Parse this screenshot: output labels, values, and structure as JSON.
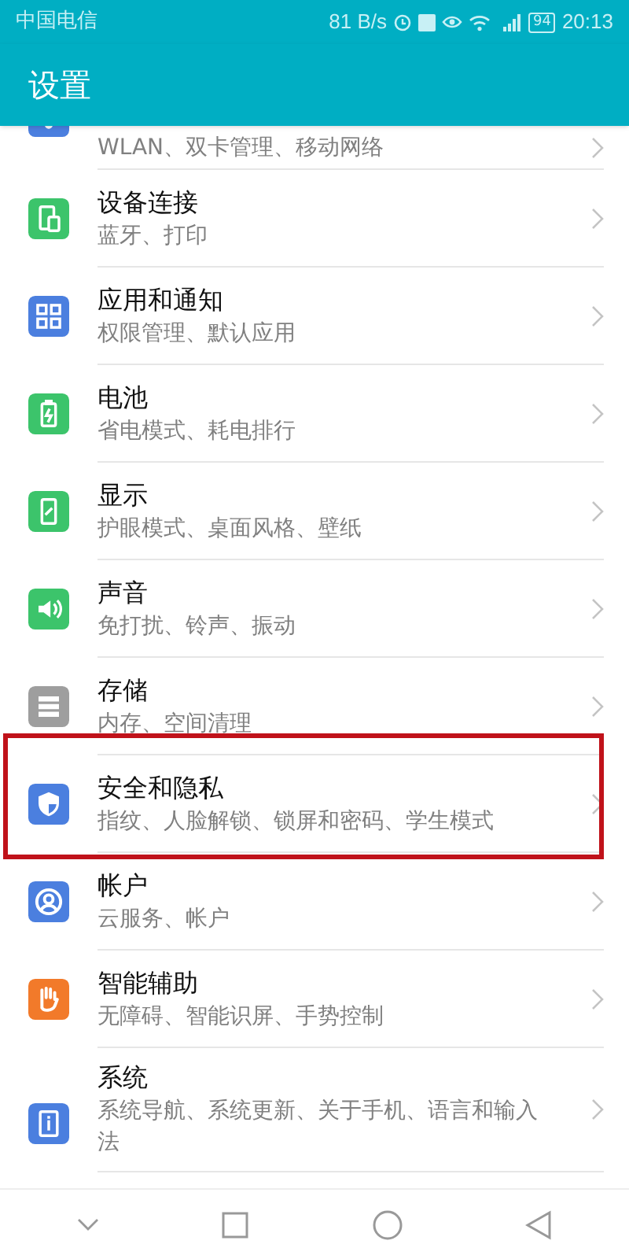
{
  "status_bar": {
    "carrier": "中国电信",
    "speed": "81 B/s",
    "battery": "94",
    "time": "20:13"
  },
  "app_bar": {
    "title": "设置"
  },
  "items": [
    {
      "kind": "wifi",
      "color": "#4b7fdf",
      "subtitle": "WLAN、双卡管理、移动网络",
      "partial": true
    },
    {
      "kind": "device",
      "color": "#3cc46b",
      "title": "设备连接",
      "subtitle": "蓝牙、打印"
    },
    {
      "kind": "apps",
      "color": "#4b7fdf",
      "title": "应用和通知",
      "subtitle": "权限管理、默认应用"
    },
    {
      "kind": "battery",
      "color": "#3cc46b",
      "title": "电池",
      "subtitle": "省电模式、耗电排行"
    },
    {
      "kind": "display",
      "color": "#3cc46b",
      "title": "显示",
      "subtitle": "护眼模式、桌面风格、壁纸"
    },
    {
      "kind": "sound",
      "color": "#3cc46b",
      "title": "声音",
      "subtitle": "免打扰、铃声、振动"
    },
    {
      "kind": "storage",
      "color": "#9e9e9e",
      "title": "存储",
      "subtitle": "内存、空间清理"
    },
    {
      "kind": "shield",
      "color": "#4b7fdf",
      "title": "安全和隐私",
      "subtitle": "指纹、人脸解锁、锁屏和密码、学生模式",
      "highlighted": true
    },
    {
      "kind": "account",
      "color": "#4b7fdf",
      "title": "帐户",
      "subtitle": "云服务、帐户"
    },
    {
      "kind": "hand",
      "color": "#f27a2a",
      "title": "智能辅助",
      "subtitle": "无障碍、智能识屏、手势控制"
    },
    {
      "kind": "info",
      "color": "#4b7fdf",
      "title": "系统",
      "subtitle": "系统导航、系统更新、关于手机、语言和输入法"
    }
  ]
}
